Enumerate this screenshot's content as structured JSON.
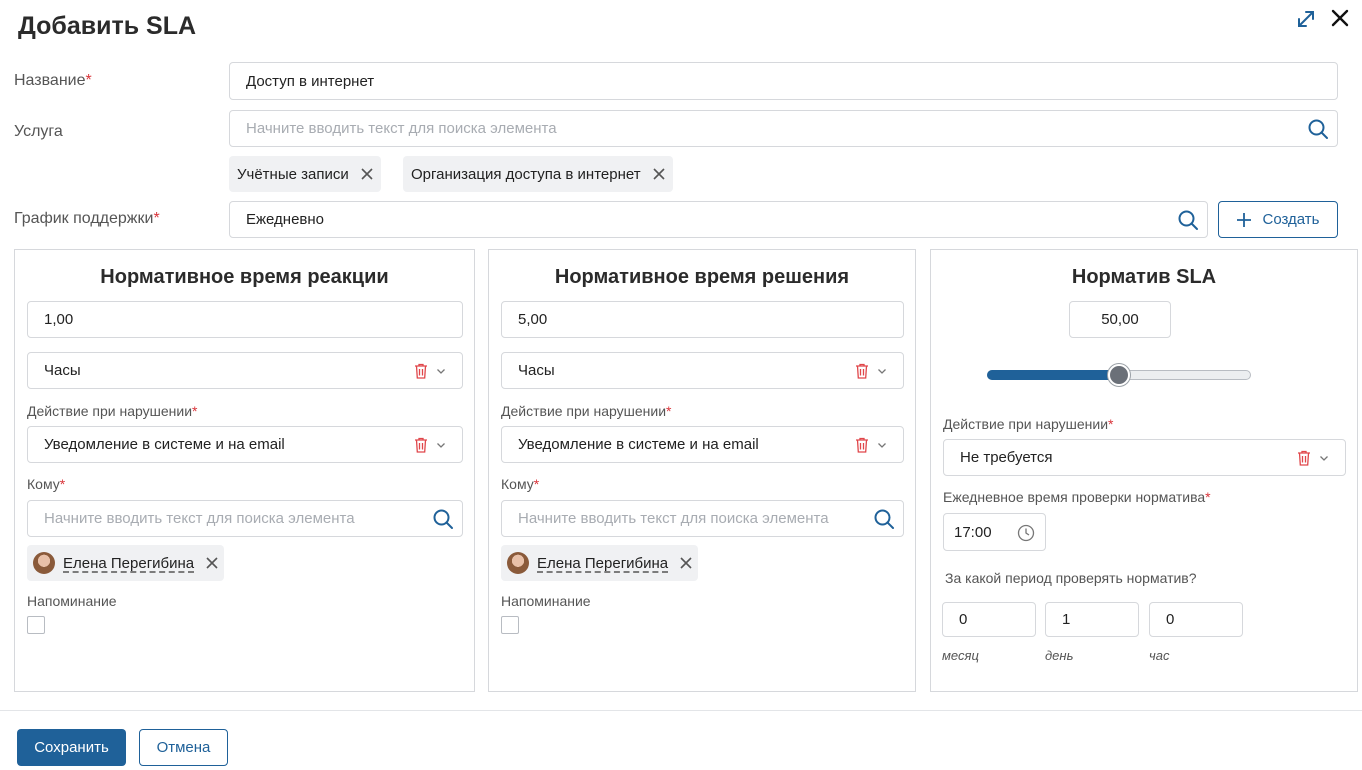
{
  "dialog": {
    "title": "Добавить SLA"
  },
  "form": {
    "name": {
      "label": "Название",
      "value": "Доступ в интернет"
    },
    "service": {
      "label": "Услуга",
      "placeholder": "Начните вводить текст для поиска элемента",
      "chips": [
        "Учётные записи",
        "Организация доступа в интернет"
      ]
    },
    "schedule": {
      "label": "График поддержки",
      "value": "Ежедневно",
      "create_label": "Создать"
    }
  },
  "reaction": {
    "title": "Нормативное время реакции",
    "value": "1,00",
    "unit": "Часы",
    "action_label": "Действие при нарушении",
    "action_value": "Уведомление в системе и на email",
    "to_label": "Кому",
    "to_placeholder": "Начните вводить текст для поиска элемента",
    "user": "Елена Перегибина",
    "reminder_label": "Напоминание"
  },
  "resolution": {
    "title": "Нормативное время решения",
    "value": "5,00",
    "unit": "Часы",
    "action_label": "Действие при нарушении",
    "action_value": "Уведомление в системе и на email",
    "to_label": "Кому",
    "to_placeholder": "Начните вводить текст для поиска элемента",
    "user": "Елена Перегибина",
    "reminder_label": "Напоминание"
  },
  "sla": {
    "title": "Норматив SLA",
    "value": "50,00",
    "slider_fraction": 0.5,
    "action_label": "Действие при нарушении",
    "action_value": "Не требуется",
    "check_time_label": "Ежедневное время проверки норматива",
    "check_time": "17:00",
    "period_label": "За какой период проверять норматив?",
    "period": {
      "months": "0",
      "days": "1",
      "hours": "0",
      "months_cap": "месяц",
      "days_cap": "день",
      "hours_cap": "час"
    }
  },
  "footer": {
    "save_label": "Сохранить",
    "cancel_label": "Отмена"
  },
  "colors": {
    "accent": "#1f6199",
    "required": "#d9343a",
    "trash": "#e0464a"
  }
}
